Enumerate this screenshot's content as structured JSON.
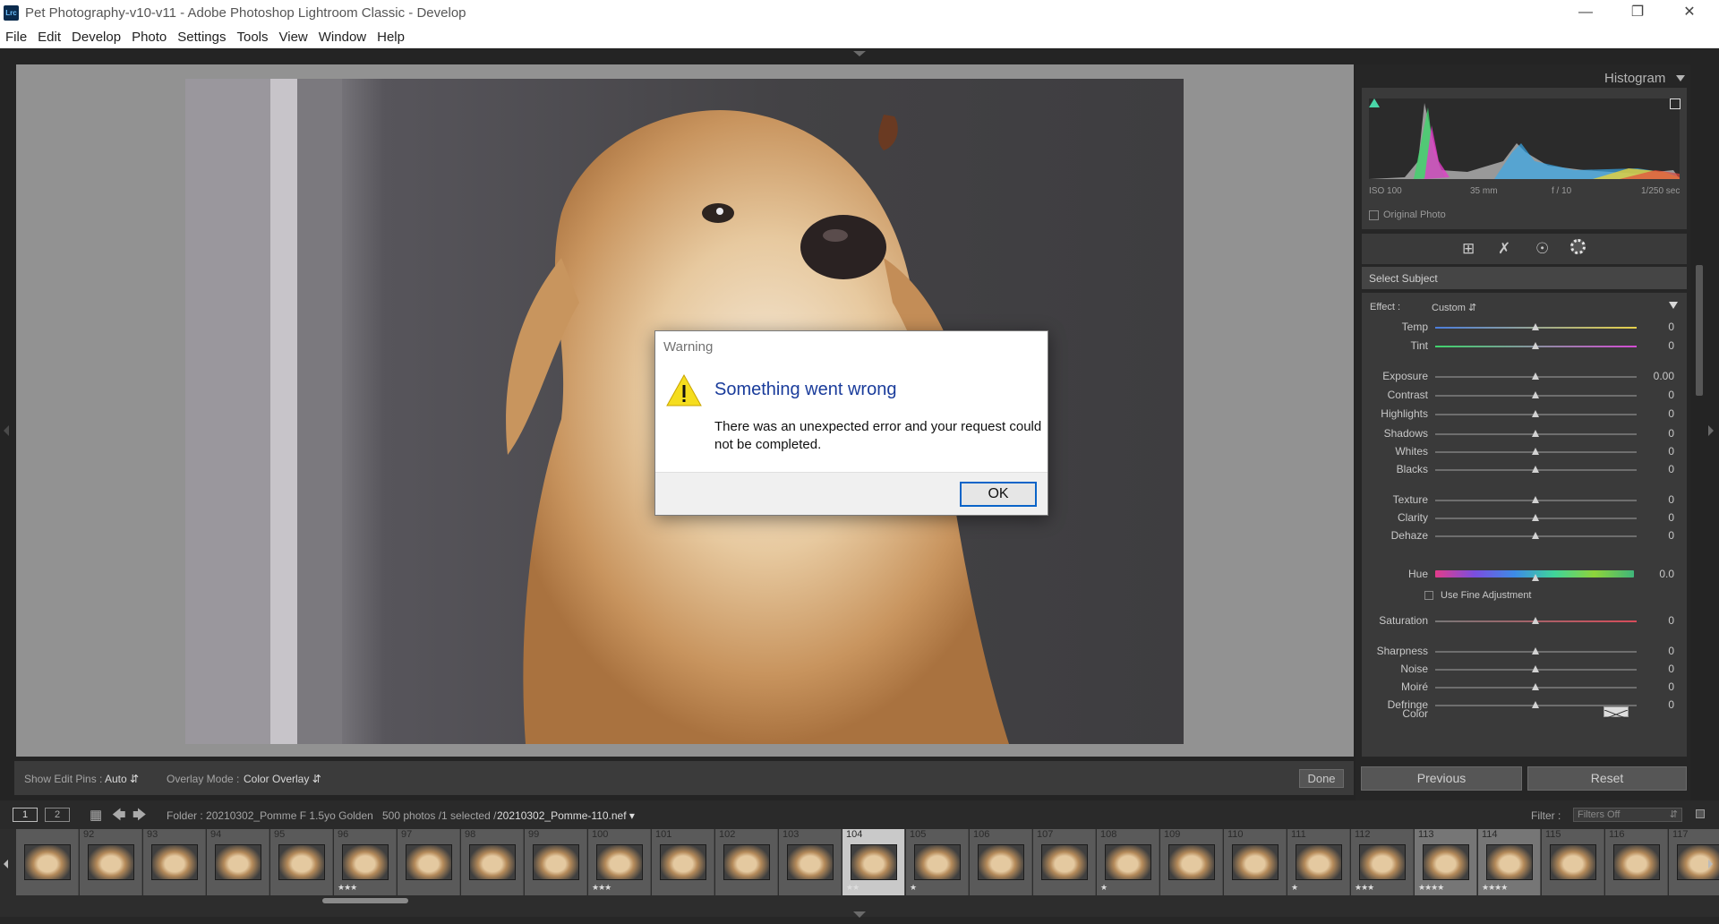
{
  "window": {
    "app_icon": "Lrc",
    "title": "Pet Photography-v10-v11 - Adobe Photoshop Lightroom Classic - Develop",
    "minimize_icon": "minimize-icon",
    "maximize_icon": "restore-icon",
    "close_icon": "close-icon"
  },
  "menu": [
    "File",
    "Edit",
    "Develop",
    "Photo",
    "Settings",
    "Tools",
    "View",
    "Window",
    "Help"
  ],
  "toolbar": {
    "show_edit_pins_label": "Show Edit Pins :",
    "show_edit_pins_value": "Auto",
    "overlay_mode_label": "Overlay Mode :",
    "overlay_mode_value": "Color Overlay",
    "done_label": "Done"
  },
  "histogram": {
    "title": "Histogram",
    "iso": "ISO 100",
    "focal": "35 mm",
    "aperture": "f / 10",
    "shutter": "1/250 sec",
    "original_photo_label": "Original Photo"
  },
  "mask": {
    "title": "Select Subject",
    "effect_label": "Effect :",
    "effect_value": "Custom",
    "hue_label": "Hue",
    "hue_value": "0.0",
    "fine_adjust_label": "Use Fine Adjustment",
    "color_label": "Color",
    "sliders": [
      {
        "label": "Temp",
        "value": "0"
      },
      {
        "label": "Tint",
        "value": "0"
      },
      {
        "label": "Exposure",
        "value": "0.00"
      },
      {
        "label": "Contrast",
        "value": "0"
      },
      {
        "label": "Highlights",
        "value": "0"
      },
      {
        "label": "Shadows",
        "value": "0"
      },
      {
        "label": "Whites",
        "value": "0"
      },
      {
        "label": "Blacks",
        "value": "0"
      },
      {
        "label": "Texture",
        "value": "0"
      },
      {
        "label": "Clarity",
        "value": "0"
      },
      {
        "label": "Dehaze",
        "value": "0"
      },
      {
        "label": "Saturation",
        "value": "0"
      },
      {
        "label": "Sharpness",
        "value": "0"
      },
      {
        "label": "Noise",
        "value": "0"
      },
      {
        "label": "Moiré",
        "value": "0"
      },
      {
        "label": "Defringe",
        "value": "0"
      }
    ],
    "previous_label": "Previous",
    "reset_label": "Reset"
  },
  "filmstrip_header": {
    "screen1": "1",
    "screen2": "2",
    "folder": "Folder : 20210302_Pomme F 1.5yo Golden",
    "count": "500 photos /1 selected /",
    "filename": "20210302_Pomme-110.nef",
    "filter_label": "Filter :",
    "filter_value": "Filters Off"
  },
  "filmstrip": [
    {
      "num": "",
      "stars": ""
    },
    {
      "num": "92",
      "stars": ""
    },
    {
      "num": "93",
      "stars": ""
    },
    {
      "num": "94",
      "stars": ""
    },
    {
      "num": "95",
      "stars": ""
    },
    {
      "num": "96",
      "stars": "★★★"
    },
    {
      "num": "97",
      "stars": ""
    },
    {
      "num": "98",
      "stars": ""
    },
    {
      "num": "99",
      "stars": ""
    },
    {
      "num": "100",
      "stars": "★★★"
    },
    {
      "num": "101",
      "stars": ""
    },
    {
      "num": "102",
      "stars": ""
    },
    {
      "num": "103",
      "stars": ""
    },
    {
      "num": "104",
      "stars": "★★"
    },
    {
      "num": "105",
      "stars": "★"
    },
    {
      "num": "106",
      "stars": ""
    },
    {
      "num": "107",
      "stars": ""
    },
    {
      "num": "108",
      "stars": "★"
    },
    {
      "num": "109",
      "stars": ""
    },
    {
      "num": "110",
      "stars": ""
    },
    {
      "num": "111",
      "stars": "★"
    },
    {
      "num": "112",
      "stars": "★★★"
    },
    {
      "num": "113",
      "stars": "★★★★"
    },
    {
      "num": "114",
      "stars": "★★★★"
    },
    {
      "num": "115",
      "stars": ""
    },
    {
      "num": "116",
      "stars": ""
    },
    {
      "num": "117",
      "stars": ""
    }
  ],
  "dialog": {
    "title": "Warning",
    "heading": "Something went wrong",
    "body": "There was an unexpected error and your request could not be completed.",
    "ok_label": "OK",
    "icon": "warning-icon"
  }
}
